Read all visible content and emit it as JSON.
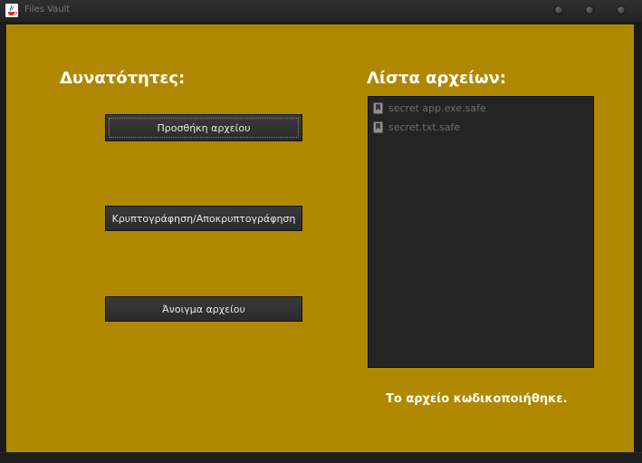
{
  "window": {
    "title": "Files Vault",
    "icon": "java-cup-icon"
  },
  "capabilities": {
    "heading": "Δυνατότητες:",
    "buttons": {
      "add_file": "Προσθήκη αρχείου",
      "encrypt_decrypt": "Κρυπτογράφηση/Αποκρυπτογράφηση",
      "open_file": "Άνοιγμα αρχείου"
    }
  },
  "file_list": {
    "heading": "Λίστα αρχείων:",
    "items": [
      {
        "name": "secret app.exe.safe",
        "icon": "file-icon"
      },
      {
        "name": "secret.txt.safe",
        "icon": "file-icon"
      }
    ]
  },
  "status": {
    "message": "Το αρχείο κωδικοποιήθηκε."
  },
  "colors": {
    "panel_background": "#b08800",
    "button_background": "#2f2f2f",
    "list_background": "#242424",
    "heading_text": "#ffffff"
  }
}
